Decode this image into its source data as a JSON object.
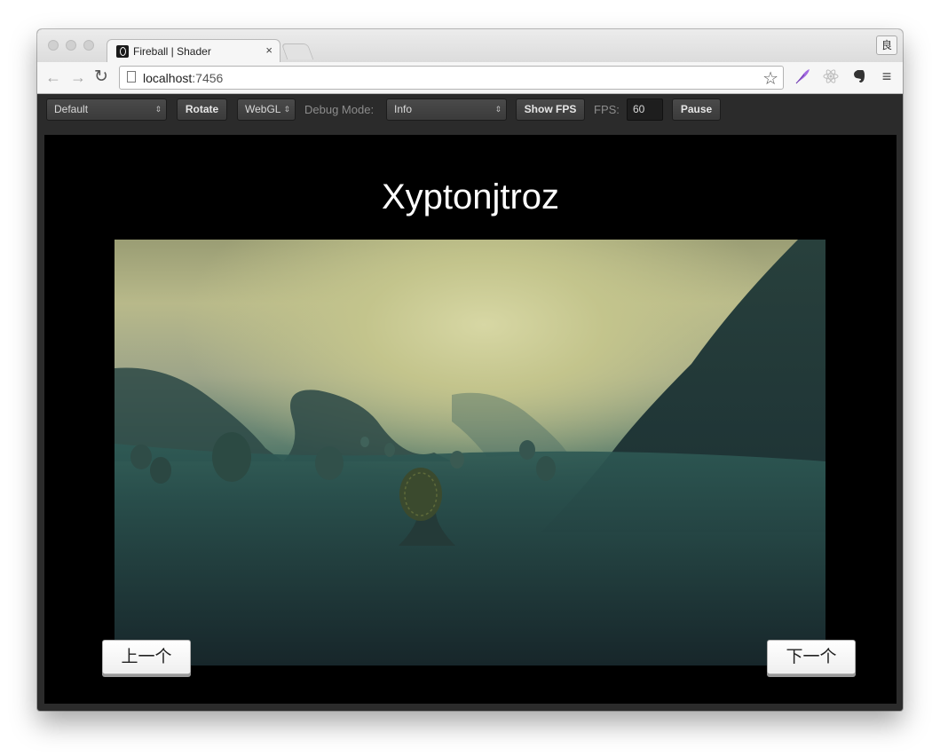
{
  "browser": {
    "tab_title": "Fireball | Shader",
    "tab_close": "×",
    "profile": "良",
    "url_host": "localhost",
    "url_port": ":7456",
    "icons": [
      "back-icon",
      "forward-icon",
      "reload-icon",
      "page-icon",
      "bookmark-star-icon",
      "feather-extension-icon",
      "react-extension-icon",
      "evernote-extension-icon",
      "menu-icon"
    ]
  },
  "toolbar": {
    "scene_select": "Default",
    "rotate_label": "Rotate",
    "renderer_select": "WebGL",
    "debug_mode_label": "Debug Mode:",
    "debug_select": "Info",
    "show_fps_label": "Show FPS",
    "fps_label": "FPS:",
    "fps_value": "60",
    "pause_label": "Pause"
  },
  "scene": {
    "title": "Xyptonjtroz",
    "prev_label": "上一个",
    "next_label": "下一个"
  },
  "colors": {
    "toolbar_bg": "#2b2b2b",
    "canvas_bg": "#000000",
    "sky": "#d7d7a4",
    "fog": "#2b5450"
  }
}
